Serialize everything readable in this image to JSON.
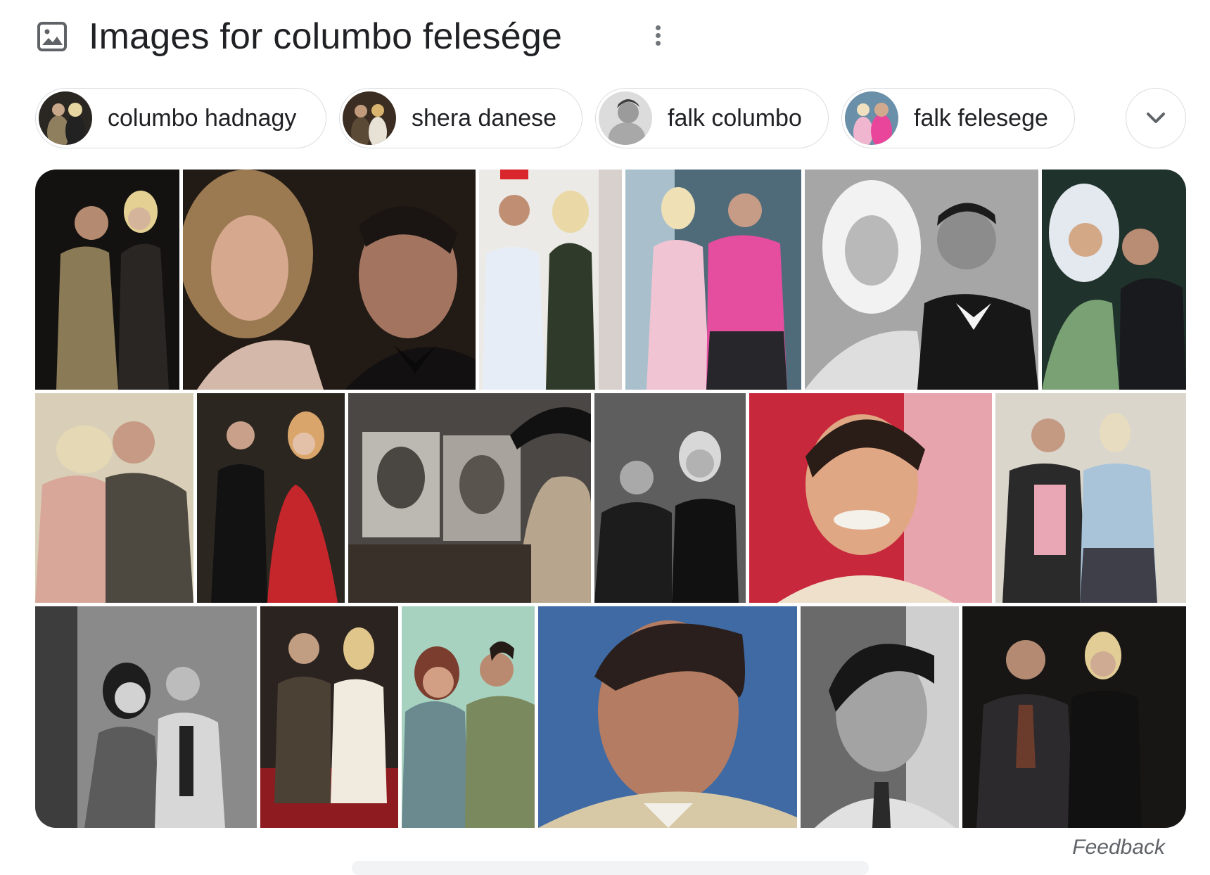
{
  "header": {
    "title": "Images for columbo felesége",
    "icon": "image-icon",
    "more_icon": "more-vert-icon"
  },
  "chips": [
    {
      "label": "columbo hadnagy"
    },
    {
      "label": "shera danese"
    },
    {
      "label": "falk columbo"
    },
    {
      "label": "falk felesege"
    }
  ],
  "expand_icon": "chevron-down-icon",
  "feedback": "Feedback"
}
